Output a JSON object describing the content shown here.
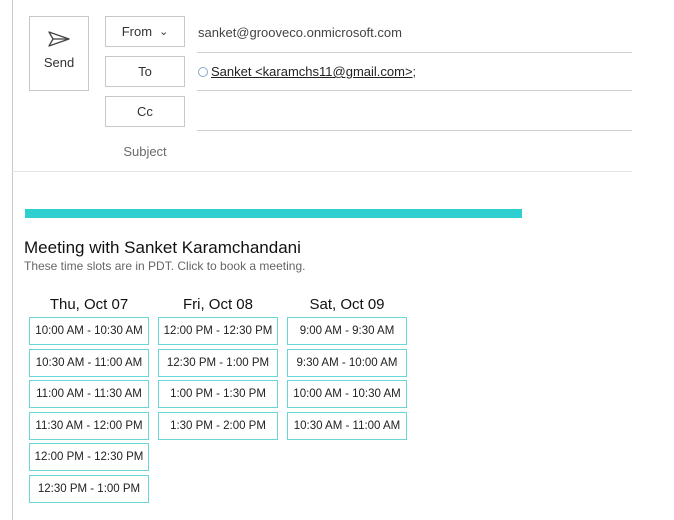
{
  "compose": {
    "send_label": "Send",
    "from_label": "From",
    "from_value": "sanket@grooveco.onmicrosoft.com",
    "to_label": "To",
    "to_recipient": "Sanket <karamchs11@gmail.com>",
    "to_sep": ";",
    "cc_label": "Cc",
    "subject_label": "Subject"
  },
  "meeting": {
    "accent_color": "#2ecfcf",
    "title": "Meeting with Sanket Karamchandani",
    "subtitle": "These time slots are in PDT. Click to book a meeting.",
    "days": [
      {
        "label": "Thu, Oct 07",
        "slots": [
          "10:00 AM - 10:30 AM",
          "10:30 AM - 11:00 AM",
          "11:00 AM - 11:30 AM",
          "11:30 AM - 12:00 PM",
          "12:00 PM - 12:30 PM",
          "12:30 PM - 1:00 PM"
        ]
      },
      {
        "label": "Fri, Oct 08",
        "slots": [
          "12:00 PM - 12:30 PM",
          "12:30 PM - 1:00 PM",
          "1:00 PM - 1:30 PM",
          "1:30 PM - 2:00 PM"
        ]
      },
      {
        "label": "Sat, Oct 09",
        "slots": [
          "9:00 AM - 9:30 AM",
          "9:30 AM - 10:00 AM",
          "10:00 AM - 10:30 AM",
          "10:30 AM - 11:00 AM"
        ]
      }
    ]
  }
}
